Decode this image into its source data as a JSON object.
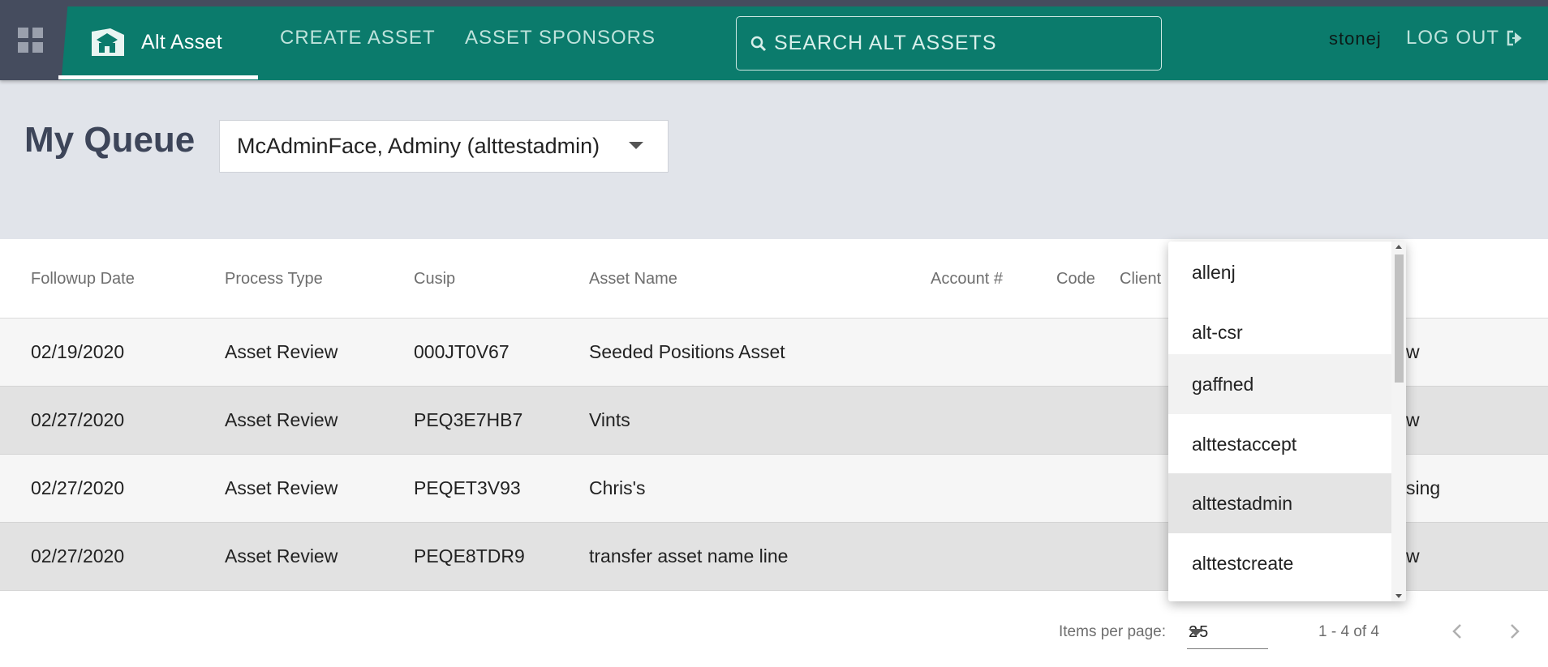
{
  "header": {
    "app_name": "Alt Asset",
    "nav": [
      "CREATE ASSET",
      "ASSET SPONSORS"
    ],
    "search_placeholder": "SEARCH ALT ASSETS",
    "username": "stonej",
    "logout_label": "LOG OUT",
    "icons": [
      "apps-grid-icon",
      "brand-logo-icon",
      "search-icon",
      "logout-icon"
    ],
    "colors": {
      "primary": "#0b7b6c",
      "dark": "#454c5e"
    }
  },
  "queue": {
    "title": "My Queue",
    "selected_user": "McAdminFace, Adminy (alttestadmin)"
  },
  "table": {
    "columns": [
      "Followup Date",
      "Process Type",
      "Cusip",
      "Asset Name",
      "Account #",
      "Code",
      "Client"
    ],
    "rows": [
      {
        "followup_date": "02/19/2020",
        "process_type": "Asset Review",
        "cusip": "000JT0V67",
        "asset_name": "Seeded Positions Asset",
        "trailing": "w"
      },
      {
        "followup_date": "02/27/2020",
        "process_type": "Asset Review",
        "cusip": "PEQ3E7HB7",
        "asset_name": "Vints",
        "trailing": "w"
      },
      {
        "followup_date": "02/27/2020",
        "process_type": "Asset Review",
        "cusip": "PEQET3V93",
        "asset_name": "Chris's",
        "trailing": "sing"
      },
      {
        "followup_date": "02/27/2020",
        "process_type": "Asset Review",
        "cusip": "PEQE8TDR9",
        "asset_name": "transfer asset name line",
        "trailing": "w"
      }
    ]
  },
  "paginator": {
    "items_per_page_label": "Items per page:",
    "items_per_page": "25",
    "range": "1 - 4 of 4"
  },
  "user_dropdown": {
    "options": [
      "allenj",
      "alt-csr",
      "gaffned",
      "alttestaccept",
      "alttestadmin",
      "alttestcreate"
    ],
    "hovered": "gaffned",
    "selected": "alttestadmin"
  }
}
